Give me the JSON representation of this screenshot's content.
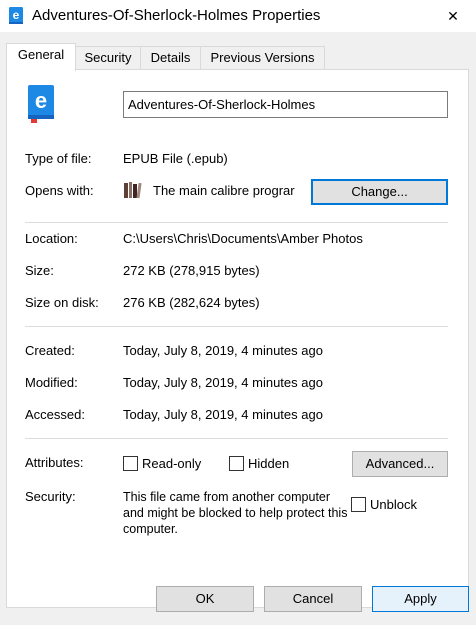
{
  "window": {
    "title": "Adventures-Of-Sherlock-Holmes Properties",
    "close_glyph": "✕"
  },
  "tabs": [
    {
      "label": "General",
      "active": true
    },
    {
      "label": "Security",
      "active": false
    },
    {
      "label": "Details",
      "active": false
    },
    {
      "label": "Previous Versions",
      "active": false
    }
  ],
  "general": {
    "file_name": "Adventures-Of-Sherlock-Holmes",
    "icon": "epub-book-icon",
    "type_label": "Type of file:",
    "type_value": "EPUB File (.epub)",
    "opens_label": "Opens with:",
    "opens_value": "The main calibre prograr",
    "opens_icon": "calibre-books-icon",
    "change_button": "Change...",
    "location_label": "Location:",
    "location_value": "C:\\Users\\Chris\\Documents\\Amber Photos",
    "size_label": "Size:",
    "size_value": "272 KB (278,915 bytes)",
    "size_on_disk_label": "Size on disk:",
    "size_on_disk_value": "276 KB (282,624 bytes)",
    "created_label": "Created:",
    "created_value": "Today, July 8, 2019, 4 minutes ago",
    "modified_label": "Modified:",
    "modified_value": "Today, July 8, 2019, 4 minutes ago",
    "accessed_label": "Accessed:",
    "accessed_value": "Today, July 8, 2019, 4 minutes ago",
    "attributes_label": "Attributes:",
    "readonly_label": "Read-only",
    "readonly_checked": false,
    "hidden_label": "Hidden",
    "hidden_checked": false,
    "advanced_button": "Advanced...",
    "security_label": "Security:",
    "security_text": "This file came from another computer and might be blocked to help protect this computer.",
    "unblock_label": "Unblock",
    "unblock_checked": false
  },
  "footer": {
    "ok": "OK",
    "cancel": "Cancel",
    "apply": "Apply"
  },
  "colors": {
    "accent": "#0078d7",
    "epub_blue": "#1e88e5"
  }
}
